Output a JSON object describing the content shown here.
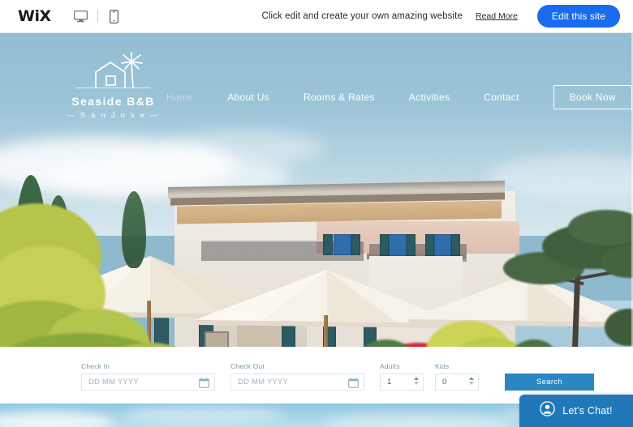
{
  "wix_bar": {
    "logo_text": "WiX",
    "desktop_icon": "desktop-monitor-icon",
    "mobile_icon": "mobile-phone-icon",
    "promo_text": "Click edit and create your own amazing website",
    "read_more_label": "Read More",
    "edit_site_label": "Edit this site",
    "edit_site_color": "#196bf0"
  },
  "site": {
    "brand": {
      "logo_icon": "house-and-palm-tree-icon",
      "name": "Seaside B&B",
      "location": "—  S a n   J o s e  —",
      "location_plain": "San Jose"
    },
    "nav": [
      {
        "label": "Home",
        "active": true
      },
      {
        "label": "About Us",
        "active": false
      },
      {
        "label": "Rooms & Rates",
        "active": false
      },
      {
        "label": "Activities",
        "active": false
      },
      {
        "label": "Contact",
        "active": false
      }
    ],
    "book_now_label": "Book Now"
  },
  "hero": {
    "alt": "Seaside villa terrace with white patio umbrellas, cypress trees, red flowers and sea view",
    "sky_color": "#9cc4d7",
    "sea_color": "#a9cadb"
  },
  "booking": {
    "check_in": {
      "label": "Check In",
      "placeholder": "DD MM YYYY",
      "value": "",
      "icon": "calendar-icon"
    },
    "check_out": {
      "label": "Check Out",
      "placeholder": "DD MM YYYY",
      "value": "",
      "icon": "calendar-icon"
    },
    "adults": {
      "label": "Adults",
      "value": "1"
    },
    "kids": {
      "label": "Kids",
      "value": "0"
    },
    "search_label": "Search",
    "search_color": "#2d86c4"
  },
  "chat": {
    "label": "Let's Chat!",
    "icon": "user-avatar-icon",
    "color": "#2178b9"
  }
}
